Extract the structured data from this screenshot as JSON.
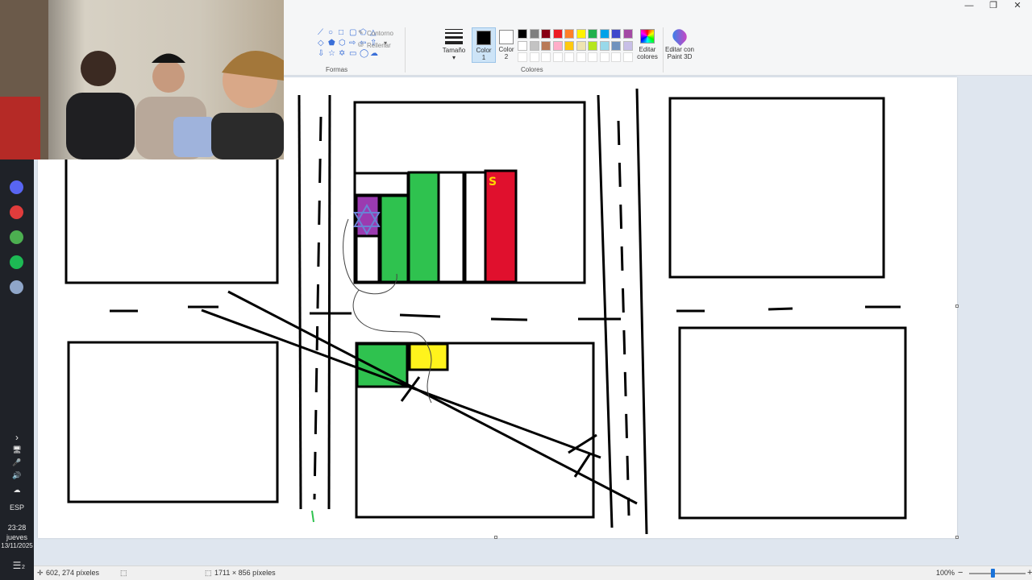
{
  "window": {
    "controls": [
      "—",
      "❐",
      "✕"
    ]
  },
  "ribbon": {
    "shapes_group_label": "Formas",
    "outline_label": "Contorno",
    "fill_label": "Rellenar",
    "size_label": "Tamaño",
    "color1_label": [
      "Color",
      "1"
    ],
    "color2_label": [
      "Color",
      "2"
    ],
    "colors_group_label": "Colores",
    "edit_colors_label": [
      "Editar",
      "colores"
    ],
    "edit_paint3d_label": [
      "Editar con",
      "Paint 3D"
    ],
    "palette": [
      "#000000",
      "#7f7f7f",
      "#880015",
      "#ed1c24",
      "#ff7f27",
      "#fff200",
      "#22b14c",
      "#00a2e8",
      "#3f48cc",
      "#a349a4",
      "#ffffff",
      "#c3c3c3",
      "#b97a57",
      "#ffaec9",
      "#ffc90e",
      "#efe4b0",
      "#b5e61d",
      "#99d9ea",
      "#7092be",
      "#c8bfe7"
    ],
    "color1_value": "#000000",
    "color2_value": "#ffffff"
  },
  "taskbar": {
    "chevron": "›",
    "tray": [
      "🖥",
      "🎤",
      "🔊",
      "☁"
    ],
    "language": "ESP",
    "time": "23:28",
    "day": "jueves",
    "date": "13/11/2025",
    "notification_count": "2",
    "app_icons": [
      "discord-icon",
      "record-icon",
      "chrome-icon",
      "spotify-icon",
      "paint-icon"
    ],
    "app_colors": [
      "#5865f2",
      "#e03c3c",
      "#4caf50",
      "#1db954",
      "#8fa6c9"
    ]
  },
  "canvas": {
    "flag_letter": "S"
  },
  "statusbar": {
    "cursor_position": "602, 274 píxeles",
    "canvas_size": "1711 × 856 píxeles",
    "zoom": "100%",
    "zoom_minus": "−",
    "zoom_plus": "+"
  }
}
